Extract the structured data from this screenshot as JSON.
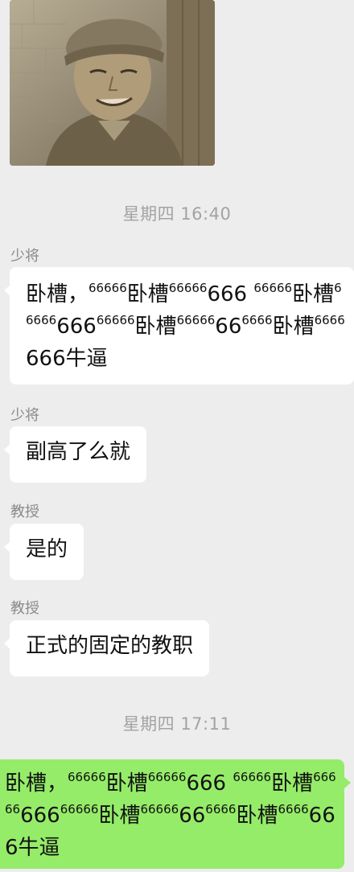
{
  "image_message": {
    "description_icon": "meme-photo"
  },
  "timestamps": {
    "first": "星期四 16:40",
    "second": "星期四 17:11"
  },
  "messages": [
    {
      "sender": "少将",
      "text_html": "卧槽，<sup>66666</sup>卧槽<sup>66666</sup>666 <sup>66666</sup>卧槽<sup>66666</sup>666<sup>66666</sup>卧槽<sup>66666</sup>66<sup>6666</sup>卧槽<sup>6666</sup>666牛逼"
    },
    {
      "sender": "少将",
      "text": "副高了么就"
    },
    {
      "sender": "教授",
      "text": "是的"
    },
    {
      "sender": "教授",
      "text": "正式的固定的教职"
    }
  ],
  "my_message": {
    "text_html": "卧槽，<sup>66666</sup>卧槽<sup>66666</sup>666 <sup>66666</sup>卧槽<sup>66666</sup>666<sup>66666</sup>卧槽<sup>66666</sup>66<sup>6666</sup>卧槽<sup>6666</sup>666牛逼"
  },
  "colors": {
    "background": "#ededed",
    "bubble_incoming": "#ffffff",
    "bubble_outgoing": "#95ec69",
    "timestamp": "#a3a3a3",
    "sender": "#8a8a8a"
  }
}
